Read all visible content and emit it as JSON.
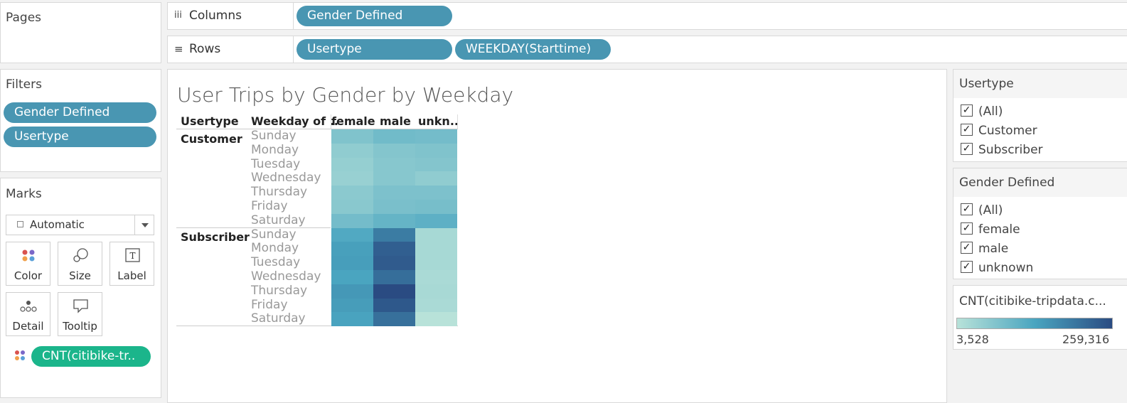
{
  "pages": {
    "title": "Pages"
  },
  "shelves": {
    "columns_icon": "iii",
    "columns_label": "Columns",
    "columns_pills": [
      "Gender Defined"
    ],
    "rows_icon": "≡",
    "rows_label": "Rows",
    "rows_pills": [
      "Usertype",
      "WEEKDAY(Starttime)"
    ]
  },
  "filters": {
    "title": "Filters",
    "items": [
      "Gender Defined",
      "Usertype"
    ]
  },
  "marks": {
    "title": "Marks",
    "type_select": "Automatic",
    "buttons": [
      "Color",
      "Size",
      "Label",
      "Detail",
      "Tooltip"
    ],
    "measure_pill": "CNT(citibike-tr.."
  },
  "viz": {
    "title": "User Trips by Gender by Weekday",
    "headers": {
      "usertype": "Usertype",
      "weekday": "Weekday of ..",
      "cols": [
        "female",
        "male",
        "unkn.."
      ]
    },
    "usertypes": [
      "Customer",
      "Subscriber"
    ],
    "weekdays": [
      "Sunday",
      "Monday",
      "Tuesday",
      "Wednesday",
      "Thursday",
      "Friday",
      "Saturday"
    ]
  },
  "chart_data": {
    "type": "heatmap",
    "title": "User Trips by Gender by Weekday",
    "columns": [
      "female",
      "male",
      "unknown"
    ],
    "rows": [
      {
        "usertype": "Customer",
        "weekday": "Sunday",
        "values": [
          20000,
          30000,
          28000
        ]
      },
      {
        "usertype": "Customer",
        "weekday": "Monday",
        "values": [
          12000,
          18000,
          20000
        ]
      },
      {
        "usertype": "Customer",
        "weekday": "Tuesday",
        "values": [
          10000,
          16000,
          18000
        ]
      },
      {
        "usertype": "Customer",
        "weekday": "Wednesday",
        "values": [
          9000,
          16000,
          12000
        ]
      },
      {
        "usertype": "Customer",
        "weekday": "Thursday",
        "values": [
          14000,
          22000,
          22000
        ]
      },
      {
        "usertype": "Customer",
        "weekday": "Friday",
        "values": [
          15000,
          24000,
          26000
        ]
      },
      {
        "usertype": "Customer",
        "weekday": "Saturday",
        "values": [
          28000,
          40000,
          46000
        ]
      },
      {
        "usertype": "Subscriber",
        "weekday": "Sunday",
        "values": [
          60000,
          140000,
          5000
        ]
      },
      {
        "usertype": "Subscriber",
        "weekday": "Monday",
        "values": [
          75000,
          205000,
          5000
        ]
      },
      {
        "usertype": "Subscriber",
        "weekday": "Tuesday",
        "values": [
          78000,
          215000,
          5000
        ]
      },
      {
        "usertype": "Subscriber",
        "weekday": "Wednesday",
        "values": [
          68000,
          170000,
          4500
        ]
      },
      {
        "usertype": "Subscriber",
        "weekday": "Thursday",
        "values": [
          88000,
          259316,
          4800
        ]
      },
      {
        "usertype": "Subscriber",
        "weekday": "Friday",
        "values": [
          80000,
          225000,
          4500
        ]
      },
      {
        "usertype": "Subscriber",
        "weekday": "Saturday",
        "values": [
          70000,
          165000,
          3528
        ]
      }
    ],
    "color_range": [
      3528,
      259316
    ],
    "color_min": "#b8e2d9",
    "color_max": "#2a4b82"
  },
  "legend_usertype": {
    "title": "Usertype",
    "items": [
      "(All)",
      "Customer",
      "Subscriber"
    ]
  },
  "legend_gender": {
    "title": "Gender Defined",
    "items": [
      "(All)",
      "female",
      "male",
      "unknown"
    ]
  },
  "color_legend": {
    "title": "CNT(citibike-tripdata.c...",
    "min_label": "3,528",
    "max_label": "259,316"
  },
  "check_mark": "✓"
}
